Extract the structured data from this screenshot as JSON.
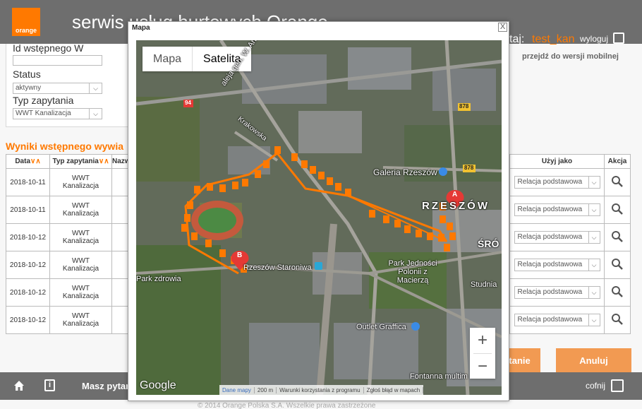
{
  "header": {
    "logo_text": "orange",
    "title": "serwis usług hurtowych Orange",
    "user_label": "taj:",
    "user_name": "test_kan",
    "logout": "wyloguj",
    "mobile_link": "przejdź do wersji mobilnej"
  },
  "filters": {
    "cut_label": "Id wstępnego W",
    "status_label": "Status",
    "status_value": "aktywny",
    "type_label": "Typ zapytania",
    "type_value": "WWT Kanalizacja"
  },
  "results": {
    "title": "Wyniki wstępnego wywia",
    "columns": [
      "Data",
      "Typ zapytania",
      "Nazw"
    ],
    "right_columns": [
      "Użyj jako",
      "Akcja"
    ],
    "rows": [
      {
        "date": "2018-10-11",
        "type_l1": "WWT",
        "type_l2": "Kanalizacja",
        "use_as": "Relacja podstawowa"
      },
      {
        "date": "2018-10-11",
        "type_l1": "WWT",
        "type_l2": "Kanalizacja",
        "use_as": "Relacja podstawowa"
      },
      {
        "date": "2018-10-12",
        "type_l1": "WWT",
        "type_l2": "Kanalizacja",
        "use_as": "Relacja podstawowa"
      },
      {
        "date": "2018-10-12",
        "type_l1": "WWT",
        "type_l2": "Kanalizacja",
        "use_as": "Relacja podstawowa"
      },
      {
        "date": "2018-10-12",
        "type_l1": "WWT",
        "type_l2": "Kanalizacja",
        "use_as": "Relacja podstawowa"
      },
      {
        "date": "2018-10-12",
        "type_l1": "WWT",
        "type_l2": "Kanalizacja",
        "use_as": "Relacja podstawowa"
      }
    ],
    "button_partial": "ytanie",
    "button_cancel": "Anuluj"
  },
  "footer": {
    "question": "Masz pytan",
    "back": "cofnij",
    "copyright": "© 2014 Orange Polska S.A. Wszelkie prawa zastrzeżone"
  },
  "modal": {
    "title": "Mapa",
    "close": "X",
    "map_type": [
      "Mapa",
      "Satelita"
    ],
    "active_map_type": "Satelita",
    "zoom_in": "+",
    "zoom_out": "−",
    "labels": {
      "aleja": "aleja gen. W. Andersa",
      "krakowska": "Krakowska",
      "galeria": "Galeria Rzeszów",
      "rzeszow": "RZESZÓW",
      "sro": "ŚRÓ",
      "staroniwa": "Rzeszów Staroniwa",
      "park_zdrowia": "Park zdrowia",
      "park_jednosci": "Park Jedności Polonii z Macierzą",
      "studnia": "Studnia",
      "outlet": "Outlet Graffica",
      "fontanna": "Fontanna multim",
      "road_94": "94",
      "road_878a": "878",
      "road_878b": "878"
    },
    "marker_a": "A",
    "marker_b": "B",
    "google": "Google",
    "attribution": [
      "Dane mapy",
      "200 m",
      "Warunki korzystania z programu",
      "Zgłoś błąd w mapach"
    ]
  },
  "colors": {
    "orange": "#ff7900",
    "header_gray": "#6e6e6e",
    "button_orange": "#f29a52"
  }
}
